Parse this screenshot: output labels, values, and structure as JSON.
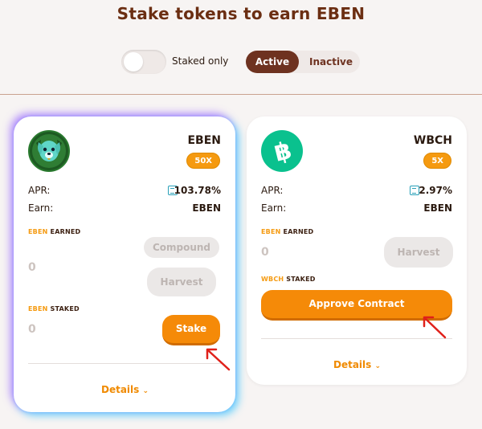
{
  "page": {
    "title": "Stake tokens to earn EBEN"
  },
  "filters": {
    "staked_only_label": "Staked only",
    "staked_only_on": false,
    "tabs": [
      {
        "label": "Active",
        "selected": true
      },
      {
        "label": "Inactive",
        "selected": false
      }
    ]
  },
  "pools": [
    {
      "name": "EBEN",
      "multiplier": "50X",
      "logo_icon": "eben-dog-icon",
      "apr_label": "APR:",
      "apr_value": "103.78%",
      "earn_label": "Earn:",
      "earn_value": "EBEN",
      "earned_accent": "EBEN",
      "earned_suffix": "EARNED",
      "earned_amount": "0",
      "compound_label": "Compound",
      "harvest_label": "Harvest",
      "staked_accent": "EBEN",
      "staked_suffix": "STAKED",
      "staked_amount": "0",
      "stake_label": "Stake",
      "details_label": "Details"
    },
    {
      "name": "WBCH",
      "multiplier": "5X",
      "logo_icon": "bitcoin-cash-icon",
      "apr_label": "APR:",
      "apr_value": "2.97%",
      "earn_label": "Earn:",
      "earn_value": "EBEN",
      "earned_accent": "EBEN",
      "earned_suffix": "EARNED",
      "earned_amount": "0",
      "harvest_label": "Harvest",
      "staked_accent": "WBCH",
      "staked_suffix": "STAKED",
      "approve_label": "Approve Contract",
      "details_label": "Details"
    }
  ],
  "colors": {
    "accent_orange": "#f58a08",
    "brand_brown": "#6e3220",
    "annotation_red": "#e0201a"
  }
}
